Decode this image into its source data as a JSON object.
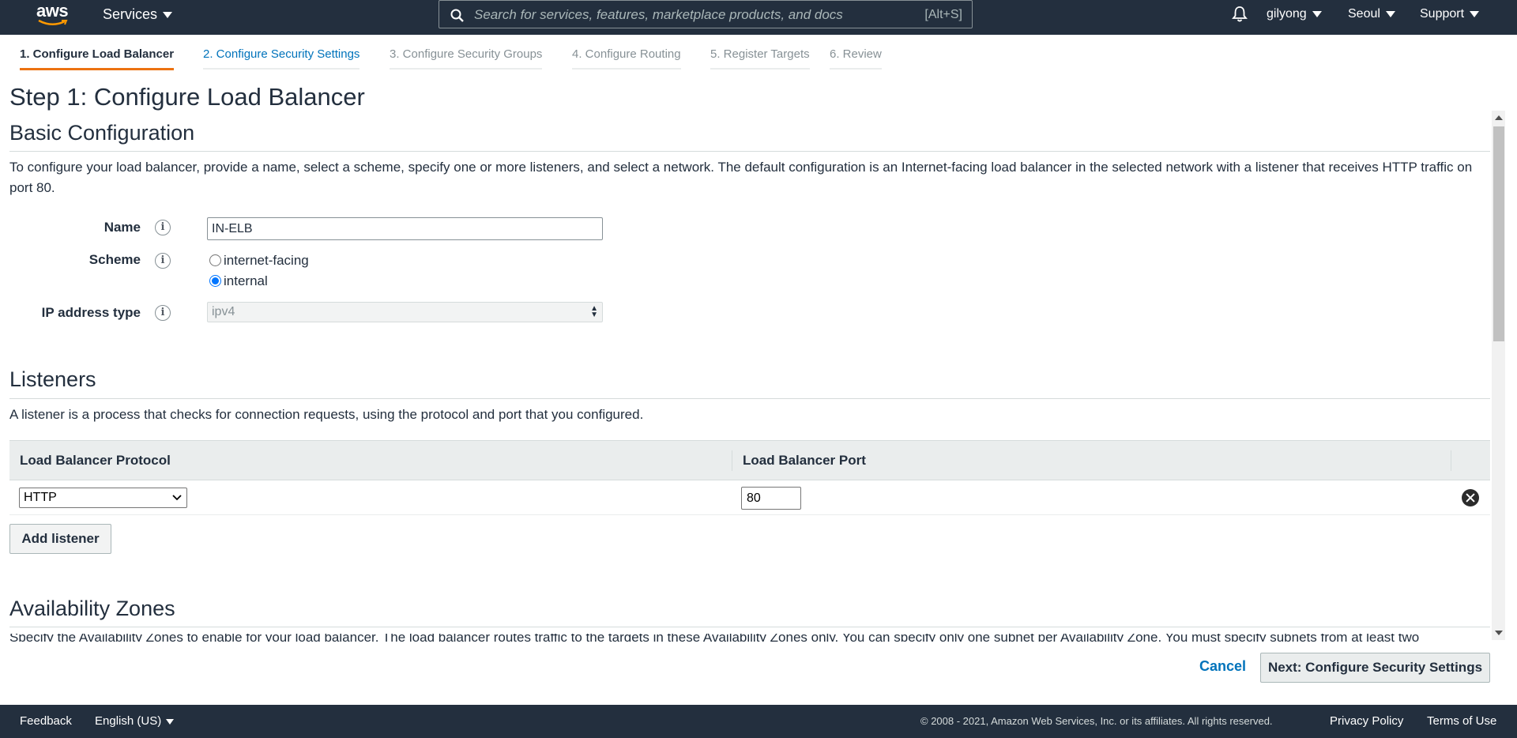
{
  "topnav": {
    "logo_text": "aws",
    "services_label": "Services",
    "search_placeholder": "Search for services, features, marketplace products, and docs",
    "search_shortcut": "[Alt+S]",
    "user": "gilyong",
    "region": "Seoul",
    "support": "Support"
  },
  "steps": [
    {
      "label": "1. Configure Load Balancer",
      "state": "active"
    },
    {
      "label": "2. Configure Security Settings",
      "state": "link"
    },
    {
      "label": "3. Configure Security Groups",
      "state": "inactive"
    },
    {
      "label": "4. Configure Routing",
      "state": "inactive"
    },
    {
      "label": "5. Register Targets",
      "state": "inactive"
    },
    {
      "label": "6. Review",
      "state": "inactive"
    }
  ],
  "page_title": "Step 1: Configure Load Balancer",
  "basic": {
    "heading": "Basic Configuration",
    "description": "To configure your load balancer, provide a name, select a scheme, specify one or more listeners, and select a network. The default configuration is an Internet-facing load balancer in the selected network with a listener that receives HTTP traffic on port 80.",
    "name_label": "Name",
    "name_value": "IN-ELB",
    "scheme_label": "Scheme",
    "scheme_options": [
      "internet-facing",
      "internal"
    ],
    "scheme_selected": "internal",
    "ip_label": "IP address type",
    "ip_value": "ipv4",
    "info_glyph": "i"
  },
  "listeners": {
    "heading": "Listeners",
    "description": "A listener is a process that checks for connection requests, using the protocol and port that you configured.",
    "col_protocol": "Load Balancer Protocol",
    "col_port": "Load Balancer Port",
    "rows": [
      {
        "protocol": "HTTP",
        "port": "80"
      }
    ],
    "add_button": "Add listener"
  },
  "availability": {
    "heading": "Availability Zones",
    "description_partial": "Specify the Availability Zones to enable for your load balancer. The load balancer routes traffic to the targets in these Availability Zones only. You can specify only one subnet per Availability Zone. You must specify subnets from at least two"
  },
  "actions": {
    "cancel": "Cancel",
    "next": "Next: Configure Security Settings"
  },
  "footer": {
    "feedback": "Feedback",
    "language": "English (US)",
    "copyright": "© 2008 - 2021, Amazon Web Services, Inc. or its affiliates. All rights reserved.",
    "privacy": "Privacy Policy",
    "terms": "Terms of Use"
  },
  "colors": {
    "nav_bg": "#232f3e",
    "accent": "#ec7211",
    "link": "#0073bb"
  }
}
